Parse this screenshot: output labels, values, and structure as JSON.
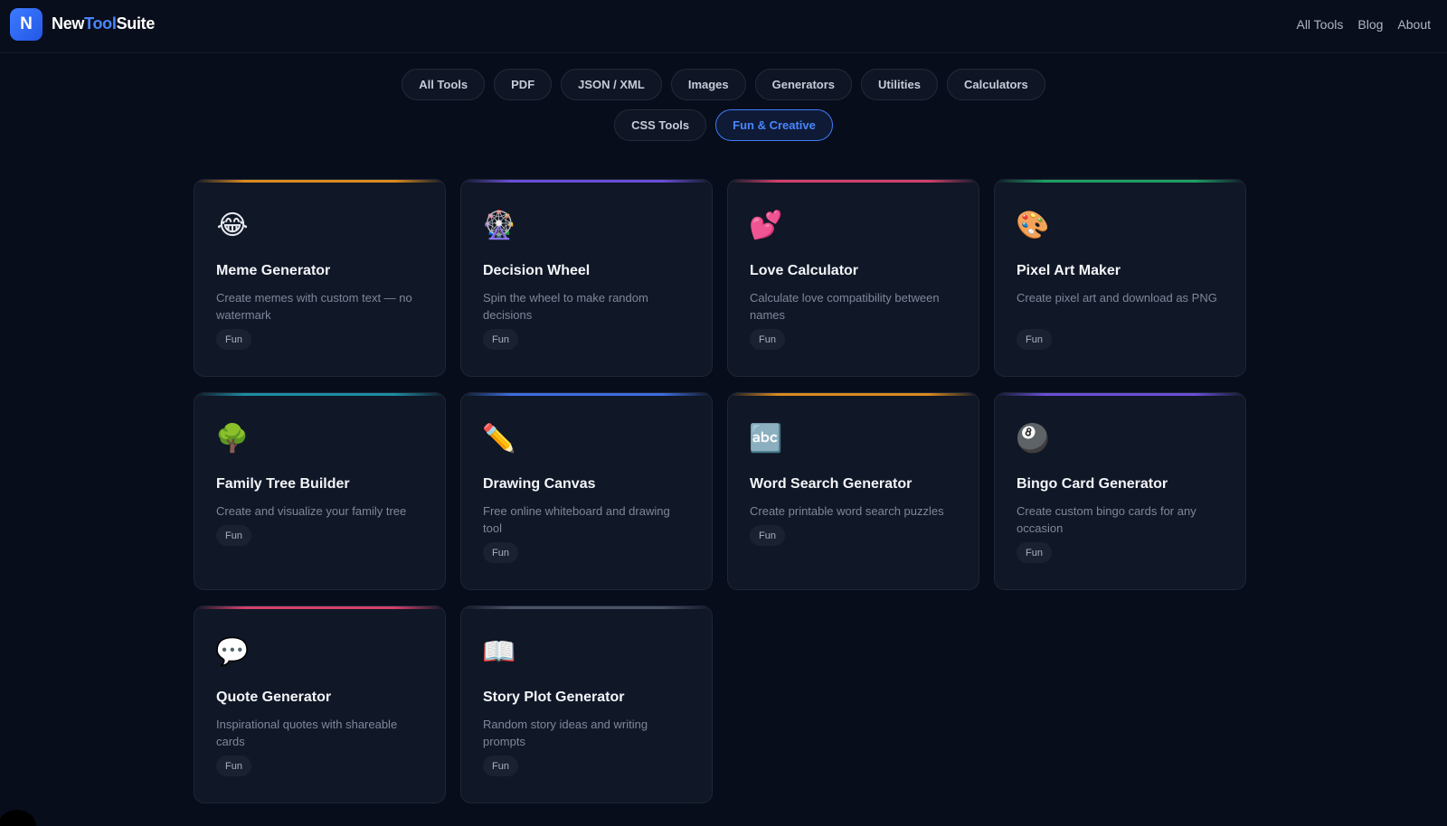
{
  "brand": {
    "badge": "N",
    "part1": "New",
    "part2": "Tool",
    "part3": "Suite"
  },
  "nav": [
    "All Tools",
    "Blog",
    "About"
  ],
  "filters": {
    "row1": [
      "All Tools",
      "PDF",
      "JSON / XML",
      "Images",
      "Generators",
      "Utilities",
      "Calculators"
    ],
    "row2": [
      "CSS Tools",
      "Fun & Creative"
    ],
    "active": "Fun & Creative"
  },
  "colors": {
    "accent_blue": "#3f7df7",
    "orange": "#d98a1e",
    "purple": "#6b4fd8",
    "pink": "#d2416c",
    "green": "#1e9e63",
    "teal": "#1d8da3",
    "blue": "#3e6ee0",
    "slate": "#4a5366"
  },
  "cards": [
    {
      "icon": "laughing-face-icon",
      "glyph": "😂",
      "accent": "#d98a1e",
      "title": "Meme Generator",
      "desc": "Create memes with custom text — no watermark",
      "tag": "Fun"
    },
    {
      "icon": "ferris-wheel-icon",
      "glyph": "🎡",
      "accent": "#6b4fd8",
      "title": "Decision Wheel",
      "desc": "Spin the wheel to make random decisions",
      "tag": "Fun"
    },
    {
      "icon": "two-hearts-icon",
      "glyph": "💕",
      "accent": "#d2416c",
      "title": "Love Calculator",
      "desc": "Calculate love compatibility between names",
      "tag": "Fun"
    },
    {
      "icon": "artist-palette-icon",
      "glyph": "🎨",
      "accent": "#1e9e63",
      "title": "Pixel Art Maker",
      "desc": "Create pixel art and download as PNG",
      "tag": "Fun"
    },
    {
      "icon": "tree-icon",
      "glyph": "🌳",
      "accent": "#1d8da3",
      "title": "Family Tree Builder",
      "desc": "Create and visualize your family tree",
      "tag": "Fun"
    },
    {
      "icon": "pencil-icon",
      "glyph": "✏️",
      "accent": "#3e6ee0",
      "title": "Drawing Canvas",
      "desc": "Free online whiteboard and drawing tool",
      "tag": "Fun"
    },
    {
      "icon": "abc-icon",
      "glyph": "🔤",
      "accent": "#d98a1e",
      "title": "Word Search Generator",
      "desc": "Create printable word search puzzles",
      "tag": "Fun"
    },
    {
      "icon": "pool-8-ball-icon",
      "glyph": "🎱",
      "accent": "#6b4fd8",
      "title": "Bingo Card Generator",
      "desc": "Create custom bingo cards for any occasion",
      "tag": "Fun"
    },
    {
      "icon": "speech-bubble-icon",
      "glyph": "💬",
      "accent": "#d2416c",
      "title": "Quote Generator",
      "desc": "Inspirational quotes with shareable cards",
      "tag": "Fun"
    },
    {
      "icon": "open-book-icon",
      "glyph": "📖",
      "accent": "#4a5366",
      "title": "Story Plot Generator",
      "desc": "Random story ideas and writing prompts",
      "tag": "Fun"
    }
  ]
}
